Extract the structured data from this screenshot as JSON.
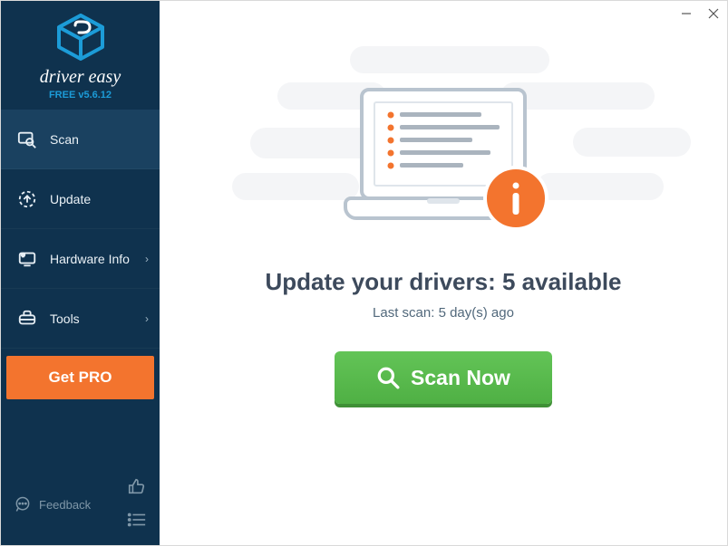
{
  "window": {
    "minimize_title": "Minimize",
    "close_title": "Close"
  },
  "sidebar": {
    "brand_name": "driver easy",
    "version": "FREE v5.6.12",
    "items": [
      {
        "label": "Scan"
      },
      {
        "label": "Update"
      },
      {
        "label": "Hardware Info"
      },
      {
        "label": "Tools"
      }
    ],
    "get_pro_label": "Get PRO",
    "feedback_label": "Feedback"
  },
  "main": {
    "headline": "Update your drivers: 5 available",
    "subline": "Last scan: 5 day(s) ago",
    "scan_button_label": "Scan Now"
  },
  "colors": {
    "accent_orange": "#f3742e",
    "accent_green": "#55b94b",
    "sidebar_bg": "#0f324e"
  }
}
